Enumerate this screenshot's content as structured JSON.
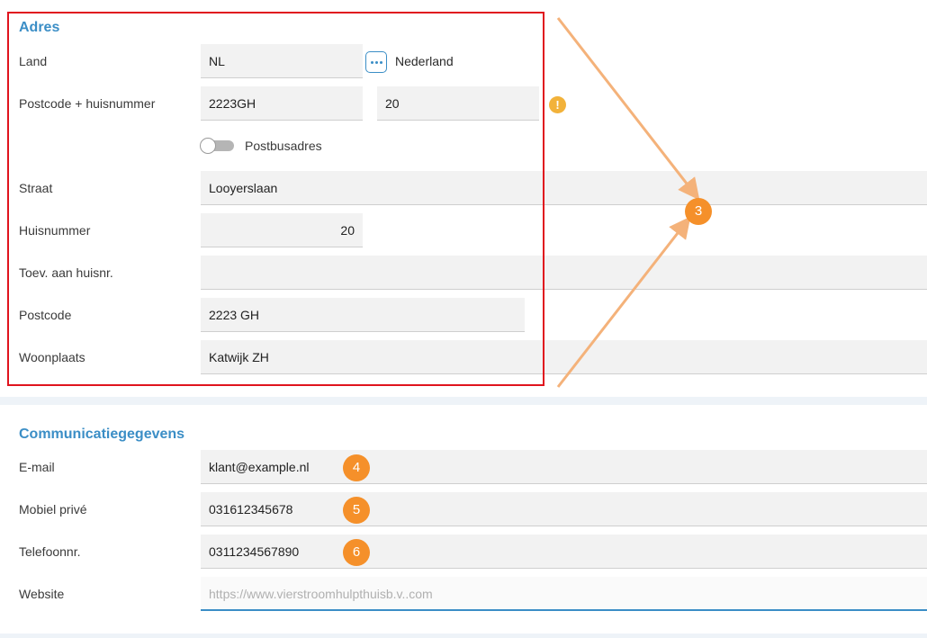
{
  "adres": {
    "title": "Adres",
    "land": {
      "label": "Land",
      "value": "NL",
      "country_name": "Nederland",
      "lookup_icon": "more-dots-icon"
    },
    "postcode_huisnummer": {
      "label": "Postcode + huisnummer",
      "postcode": "2223GH",
      "huisnummer": "20",
      "warning_icon": "warning-icon",
      "warning_symbol": "!"
    },
    "postbus": {
      "label": "Postbusadres"
    },
    "straat": {
      "label": "Straat",
      "value": "Looyerslaan"
    },
    "huisnummer": {
      "label": "Huisnummer",
      "value": "20"
    },
    "toevoeging": {
      "label": "Toev. aan huisnr.",
      "value": ""
    },
    "postcode": {
      "label": "Postcode",
      "value": "2223 GH"
    },
    "woonplaats": {
      "label": "Woonplaats",
      "value": "Katwijk ZH"
    }
  },
  "communicatie": {
    "title": "Communicatiegegevens",
    "email": {
      "label": "E-mail",
      "value": "klant@example.nl"
    },
    "mobiel": {
      "label": "Mobiel privé",
      "value": "031612345678"
    },
    "telefoon": {
      "label": "Telefoonnr.",
      "value": "0311234567890"
    },
    "website": {
      "label": "Website",
      "placeholder": "https://www.vierstroomhulpthuisb.v..com"
    }
  },
  "annotations": {
    "badge_3": "3",
    "badge_4": "4",
    "badge_5": "5",
    "badge_6": "6",
    "highlight_color": "#e0141e",
    "badge_color": "#f5902a",
    "arrow_color": "#f4b27a"
  }
}
